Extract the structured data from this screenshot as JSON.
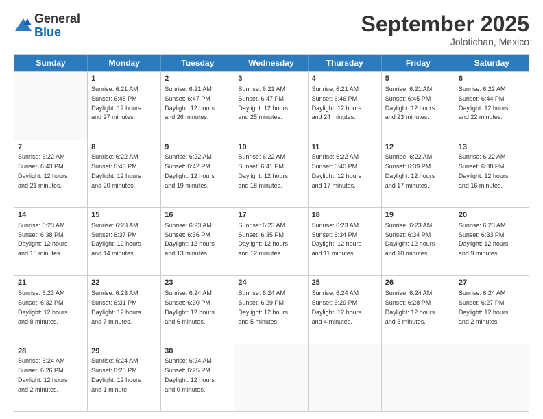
{
  "logo": {
    "general": "General",
    "blue": "Blue"
  },
  "title": "September 2025",
  "location": "Jolotichan, Mexico",
  "days": [
    "Sunday",
    "Monday",
    "Tuesday",
    "Wednesday",
    "Thursday",
    "Friday",
    "Saturday"
  ],
  "weeks": [
    [
      {
        "day": "",
        "empty": true
      },
      {
        "day": "1",
        "sunrise": "6:21 AM",
        "sunset": "6:48 PM",
        "daylight": "12 hours and 27 minutes."
      },
      {
        "day": "2",
        "sunrise": "6:21 AM",
        "sunset": "6:47 PM",
        "daylight": "12 hours and 26 minutes."
      },
      {
        "day": "3",
        "sunrise": "6:21 AM",
        "sunset": "6:47 PM",
        "daylight": "12 hours and 25 minutes."
      },
      {
        "day": "4",
        "sunrise": "6:21 AM",
        "sunset": "6:46 PM",
        "daylight": "12 hours and 24 minutes."
      },
      {
        "day": "5",
        "sunrise": "6:21 AM",
        "sunset": "6:45 PM",
        "daylight": "12 hours and 23 minutes."
      },
      {
        "day": "6",
        "sunrise": "6:22 AM",
        "sunset": "6:44 PM",
        "daylight": "12 hours and 22 minutes."
      }
    ],
    [
      {
        "day": "7",
        "sunrise": "6:22 AM",
        "sunset": "6:43 PM",
        "daylight": "12 hours and 21 minutes."
      },
      {
        "day": "8",
        "sunrise": "6:22 AM",
        "sunset": "6:43 PM",
        "daylight": "12 hours and 20 minutes."
      },
      {
        "day": "9",
        "sunrise": "6:22 AM",
        "sunset": "6:42 PM",
        "daylight": "12 hours and 19 minutes."
      },
      {
        "day": "10",
        "sunrise": "6:22 AM",
        "sunset": "6:41 PM",
        "daylight": "12 hours and 18 minutes."
      },
      {
        "day": "11",
        "sunrise": "6:22 AM",
        "sunset": "6:40 PM",
        "daylight": "12 hours and 17 minutes."
      },
      {
        "day": "12",
        "sunrise": "6:22 AM",
        "sunset": "6:39 PM",
        "daylight": "12 hours and 17 minutes."
      },
      {
        "day": "13",
        "sunrise": "6:22 AM",
        "sunset": "6:38 PM",
        "daylight": "12 hours and 16 minutes."
      }
    ],
    [
      {
        "day": "14",
        "sunrise": "6:23 AM",
        "sunset": "6:38 PM",
        "daylight": "12 hours and 15 minutes."
      },
      {
        "day": "15",
        "sunrise": "6:23 AM",
        "sunset": "6:37 PM",
        "daylight": "12 hours and 14 minutes."
      },
      {
        "day": "16",
        "sunrise": "6:23 AM",
        "sunset": "6:36 PM",
        "daylight": "12 hours and 13 minutes."
      },
      {
        "day": "17",
        "sunrise": "6:23 AM",
        "sunset": "6:35 PM",
        "daylight": "12 hours and 12 minutes."
      },
      {
        "day": "18",
        "sunrise": "6:23 AM",
        "sunset": "6:34 PM",
        "daylight": "12 hours and 11 minutes."
      },
      {
        "day": "19",
        "sunrise": "6:23 AM",
        "sunset": "6:34 PM",
        "daylight": "12 hours and 10 minutes."
      },
      {
        "day": "20",
        "sunrise": "6:23 AM",
        "sunset": "6:33 PM",
        "daylight": "12 hours and 9 minutes."
      }
    ],
    [
      {
        "day": "21",
        "sunrise": "6:23 AM",
        "sunset": "6:32 PM",
        "daylight": "12 hours and 8 minutes."
      },
      {
        "day": "22",
        "sunrise": "6:23 AM",
        "sunset": "6:31 PM",
        "daylight": "12 hours and 7 minutes."
      },
      {
        "day": "23",
        "sunrise": "6:24 AM",
        "sunset": "6:30 PM",
        "daylight": "12 hours and 6 minutes."
      },
      {
        "day": "24",
        "sunrise": "6:24 AM",
        "sunset": "6:29 PM",
        "daylight": "12 hours and 5 minutes."
      },
      {
        "day": "25",
        "sunrise": "6:24 AM",
        "sunset": "6:29 PM",
        "daylight": "12 hours and 4 minutes."
      },
      {
        "day": "26",
        "sunrise": "6:24 AM",
        "sunset": "6:28 PM",
        "daylight": "12 hours and 3 minutes."
      },
      {
        "day": "27",
        "sunrise": "6:24 AM",
        "sunset": "6:27 PM",
        "daylight": "12 hours and 2 minutes."
      }
    ],
    [
      {
        "day": "28",
        "sunrise": "6:24 AM",
        "sunset": "6:26 PM",
        "daylight": "12 hours and 2 minutes."
      },
      {
        "day": "29",
        "sunrise": "6:24 AM",
        "sunset": "6:25 PM",
        "daylight": "12 hours and 1 minute."
      },
      {
        "day": "30",
        "sunrise": "6:24 AM",
        "sunset": "6:25 PM",
        "daylight": "12 hours and 0 minutes."
      },
      {
        "day": "",
        "empty": true
      },
      {
        "day": "",
        "empty": true
      },
      {
        "day": "",
        "empty": true
      },
      {
        "day": "",
        "empty": true
      }
    ]
  ]
}
